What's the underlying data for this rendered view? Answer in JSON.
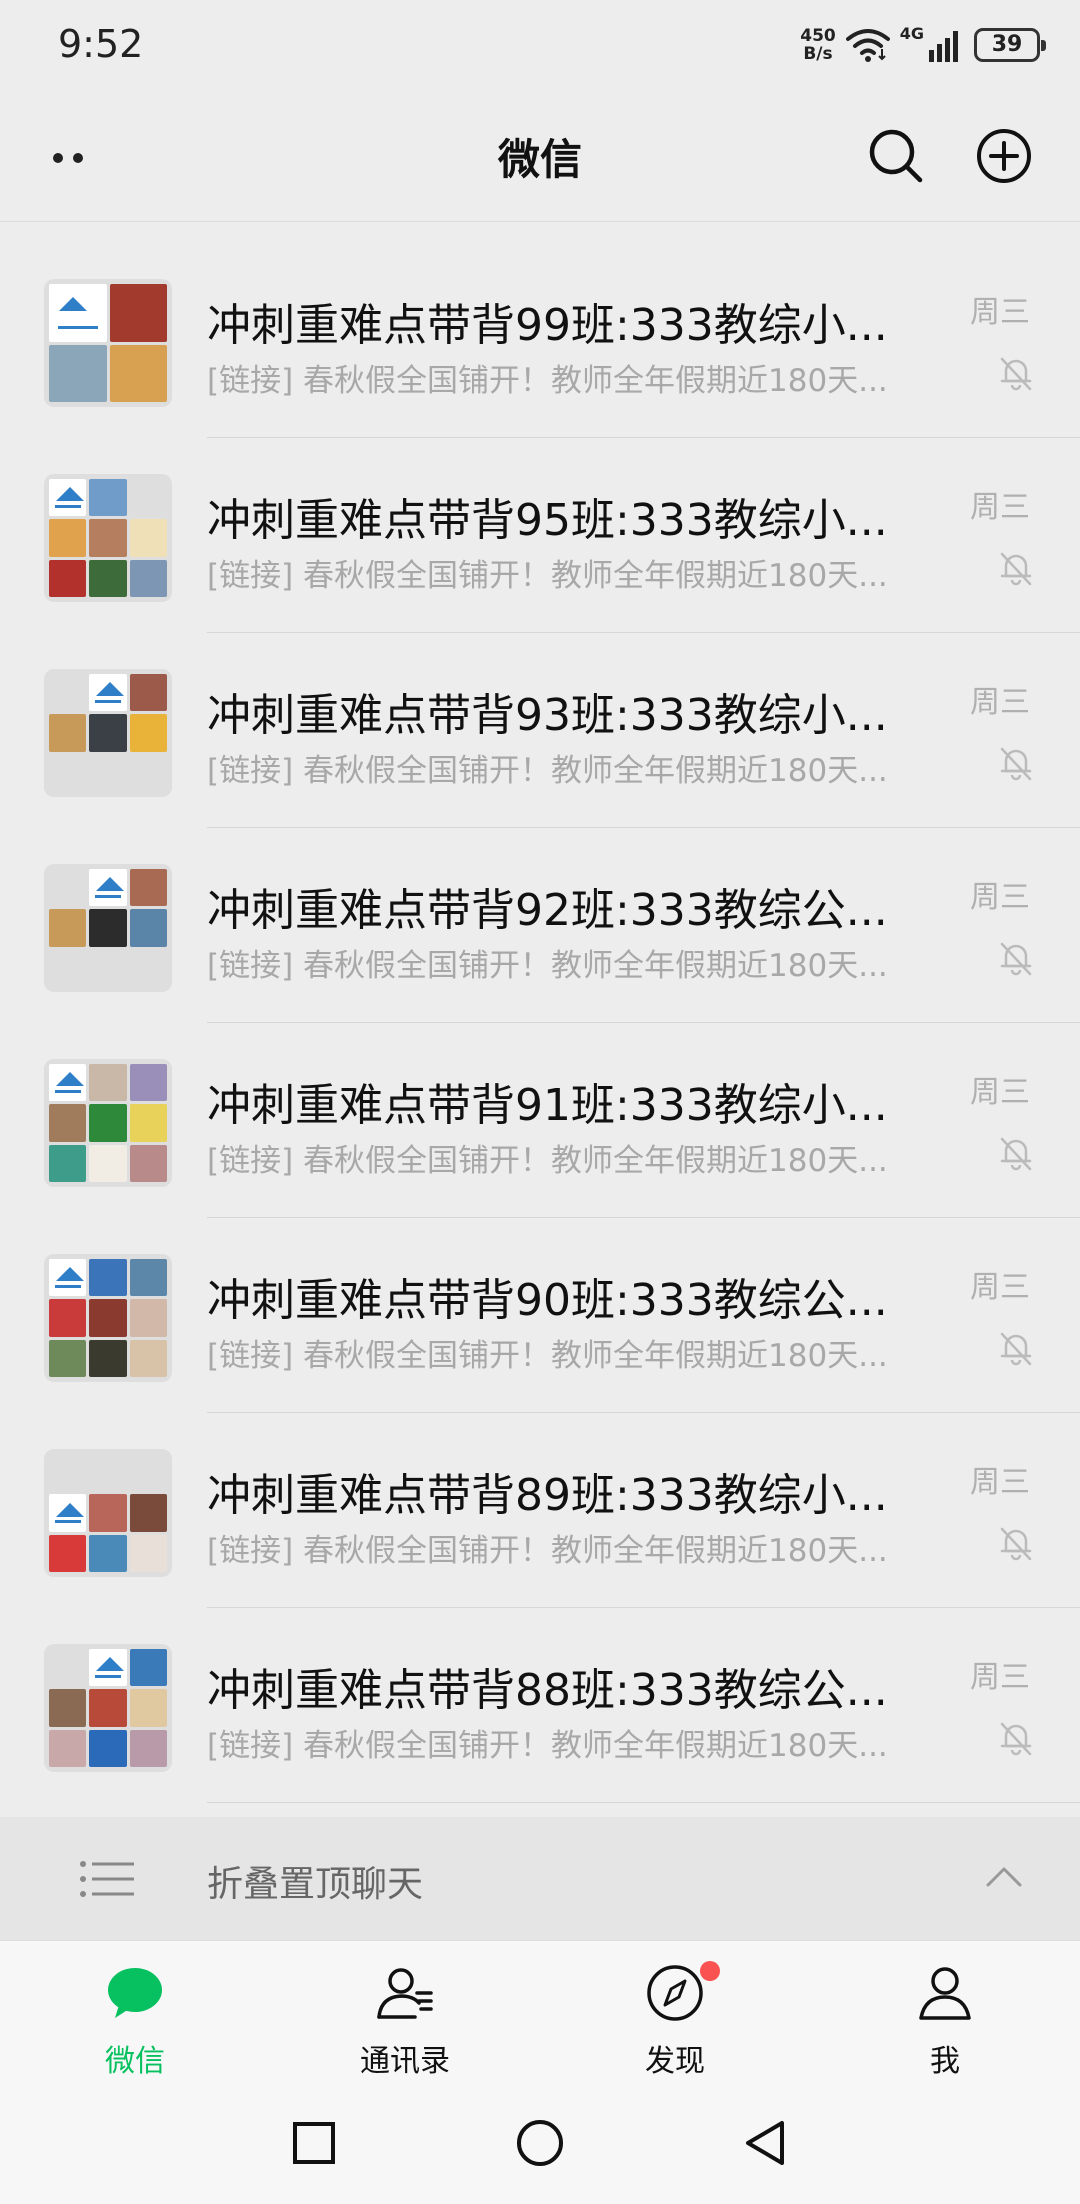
{
  "status_bar": {
    "time": "9:52",
    "net_speed_value": "450",
    "net_speed_unit": "B/s",
    "network": "4G",
    "battery": "39"
  },
  "header": {
    "title": "微信",
    "icons": [
      "more-icon",
      "search-icon",
      "add-icon"
    ]
  },
  "chats": [
    {
      "name": "冲刺重难点带背99班:333教综小...",
      "preview": "[链接] 春秋假全国铺开！教师全年假期近180天...",
      "time": "周三",
      "muted": true
    },
    {
      "name": "冲刺重难点带背95班:333教综小...",
      "preview": "[链接] 春秋假全国铺开！教师全年假期近180天...",
      "time": "周三",
      "muted": true
    },
    {
      "name": "冲刺重难点带背93班:333教综小...",
      "preview": "[链接] 春秋假全国铺开！教师全年假期近180天...",
      "time": "周三",
      "muted": true
    },
    {
      "name": "冲刺重难点带背92班:333教综公...",
      "preview": "[链接] 春秋假全国铺开！教师全年假期近180天...",
      "time": "周三",
      "muted": true
    },
    {
      "name": "冲刺重难点带背91班:333教综小...",
      "preview": "[链接] 春秋假全国铺开！教师全年假期近180天...",
      "time": "周三",
      "muted": true
    },
    {
      "name": "冲刺重难点带背90班:333教综公...",
      "preview": "[链接] 春秋假全国铺开！教师全年假期近180天...",
      "time": "周三",
      "muted": true
    },
    {
      "name": "冲刺重难点带背89班:333教综小...",
      "preview": "[链接] 春秋假全国铺开！教师全年假期近180天...",
      "time": "周三",
      "muted": true
    },
    {
      "name": "冲刺重难点带背88班:333教综公...",
      "preview": "[链接] 春秋假全国铺开！教师全年假期近180天...",
      "time": "周三",
      "muted": true
    }
  ],
  "fold": {
    "label": "折叠置顶聊天"
  },
  "tabs": [
    {
      "label": "微信",
      "icon": "chat-bubble-icon",
      "active": true
    },
    {
      "label": "通讯录",
      "icon": "contacts-icon",
      "active": false
    },
    {
      "label": "发现",
      "icon": "compass-icon",
      "active": false,
      "badge": true
    },
    {
      "label": "我",
      "icon": "person-icon",
      "active": false
    }
  ],
  "colors": {
    "accent": "#07c160",
    "background": "#ededed",
    "badge": "#fa5151"
  }
}
